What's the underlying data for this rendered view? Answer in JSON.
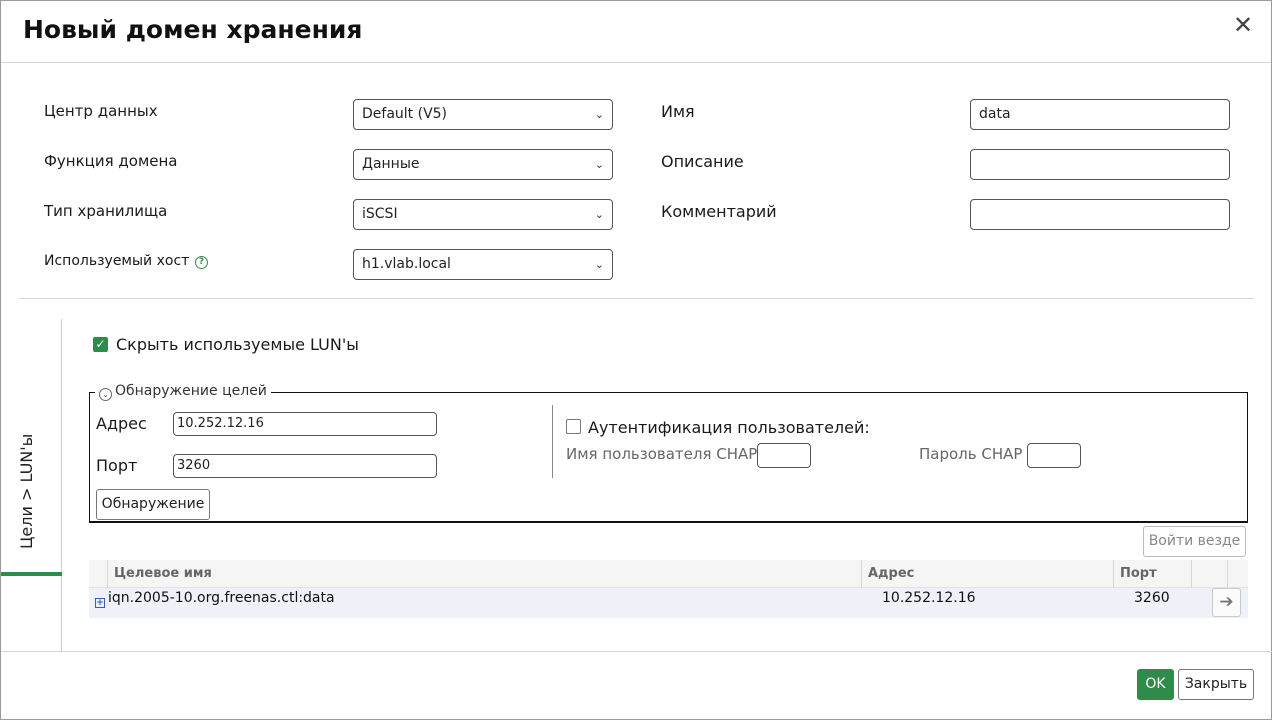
{
  "dialog": {
    "title": "Новый домен хранения",
    "close_symbol": "✕"
  },
  "form": {
    "data_center": {
      "label": "Центр данных",
      "value": "Default (V5)"
    },
    "domain_function": {
      "label": "Функция домена",
      "value": "Данные"
    },
    "storage_type": {
      "label": "Тип хранилища",
      "value": "iSCSI"
    },
    "used_host": {
      "label": "Используемый хост",
      "value": "h1.vlab.local",
      "help_symbol": "?"
    },
    "name": {
      "label": "Имя",
      "value": "data"
    },
    "description": {
      "label": "Описание",
      "value": ""
    },
    "comment": {
      "label": "Комментарий",
      "value": ""
    }
  },
  "side_tab": {
    "label": "Цели > LUN'ы"
  },
  "hide_used_luns": {
    "label": "Скрыть используемые LUN'ы",
    "checked": true,
    "check_symbol": "✓"
  },
  "discovery": {
    "legend": "Обнаружение целей",
    "legend_icon": "⌄",
    "address_label": "Адрес",
    "address_value": "10.252.12.16",
    "port_label": "Порт",
    "port_value": "3260",
    "discover_button": "Обнаружение",
    "auth_label": "Аутентификация пользователей:",
    "chap_user_label": "Имя пользователя CHAP",
    "chap_password_label": "Пароль CHAP"
  },
  "login_all_button": "Войти везде",
  "targets_table": {
    "columns": [
      "Целевое имя",
      "Адрес",
      "Порт"
    ],
    "rows": [
      {
        "target": "iqn.2005-10.org.freenas.ctl:data",
        "address": "10.252.12.16",
        "port": "3260"
      }
    ],
    "expand_symbol": "+",
    "arrow_symbol": "➔"
  },
  "footer": {
    "ok_button": "OK",
    "close_button": "Закрыть"
  },
  "colors": {
    "accent": "#2e8b4a"
  }
}
